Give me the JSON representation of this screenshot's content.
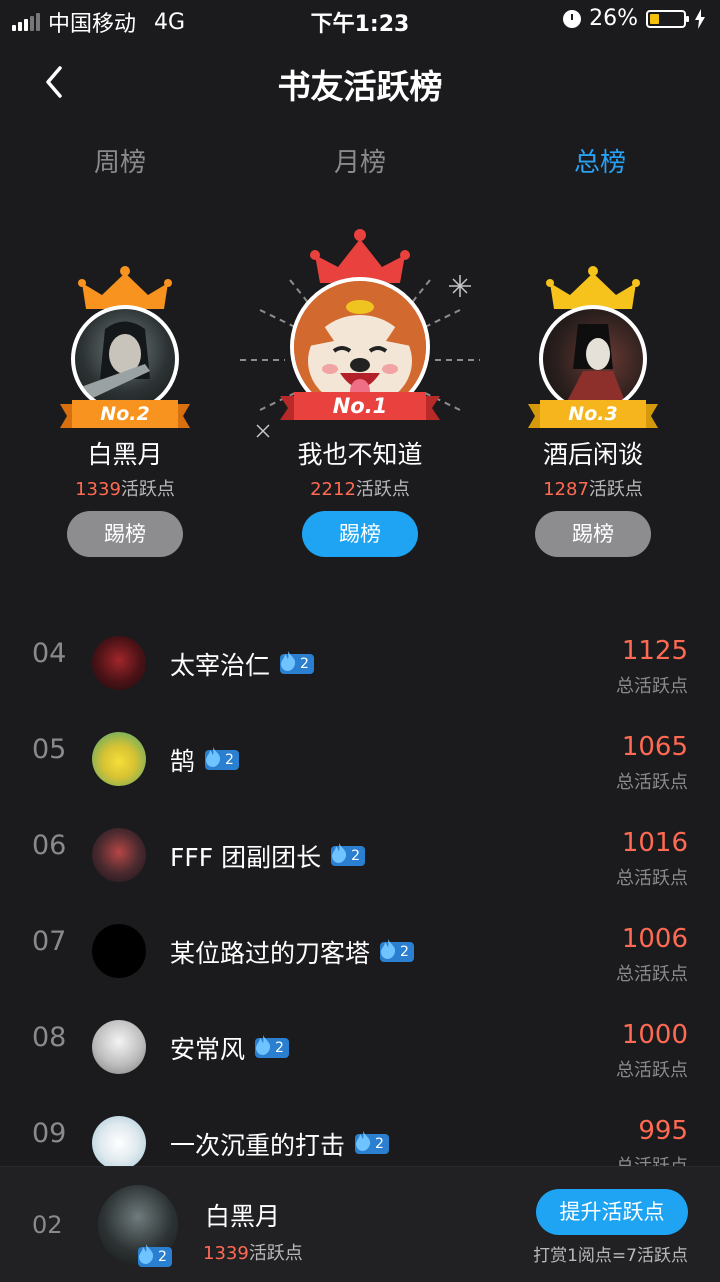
{
  "status_bar": {
    "carrier": "中国移动",
    "network": "4G",
    "time": "下午1:23",
    "battery": "26%"
  },
  "header": {
    "title": "书友活跃榜"
  },
  "tabs": [
    {
      "label": "周榜",
      "active": false
    },
    {
      "label": "月榜",
      "active": false
    },
    {
      "label": "总榜",
      "active": true
    }
  ],
  "podium": {
    "first": {
      "badge": "No.1",
      "name": "我也不知道",
      "points": "2212",
      "points_suffix": "活跃点",
      "button": "踢榜"
    },
    "second": {
      "badge": "No.2",
      "name": "白黑月",
      "points": "1339",
      "points_suffix": "活跃点",
      "button": "踢榜"
    },
    "third": {
      "badge": "No.3",
      "name": "酒后闲谈",
      "points": "1287",
      "points_suffix": "活跃点",
      "button": "踢榜"
    }
  },
  "list": [
    {
      "rank": "04",
      "name": "太宰治仁",
      "level": "2",
      "score": "1125",
      "label": "总活跃点"
    },
    {
      "rank": "05",
      "name": "鹄",
      "level": "2",
      "score": "1065",
      "label": "总活跃点"
    },
    {
      "rank": "06",
      "name": "FFF 团副团长",
      "level": "2",
      "score": "1016",
      "label": "总活跃点"
    },
    {
      "rank": "07",
      "name": "某位路过的刀客塔",
      "level": "2",
      "score": "1006",
      "label": "总活跃点"
    },
    {
      "rank": "08",
      "name": "安常风",
      "level": "2",
      "score": "1000",
      "label": "总活跃点"
    },
    {
      "rank": "09",
      "name": "一次沉重的打击",
      "level": "2",
      "score": "995",
      "label": "总活跃点"
    }
  ],
  "my_rank": {
    "rank": "02",
    "name": "白黑月",
    "level": "2",
    "points": "1339",
    "points_suffix": "活跃点",
    "button": "提升活跃点",
    "note": "打赏1阅点=7活跃点"
  },
  "colors": {
    "accent": "#1ea4f2",
    "score": "#ff6a52",
    "crown_orange": "#f7931e",
    "crown_gold": "#f6c21c",
    "crown_red": "#e8413e"
  }
}
